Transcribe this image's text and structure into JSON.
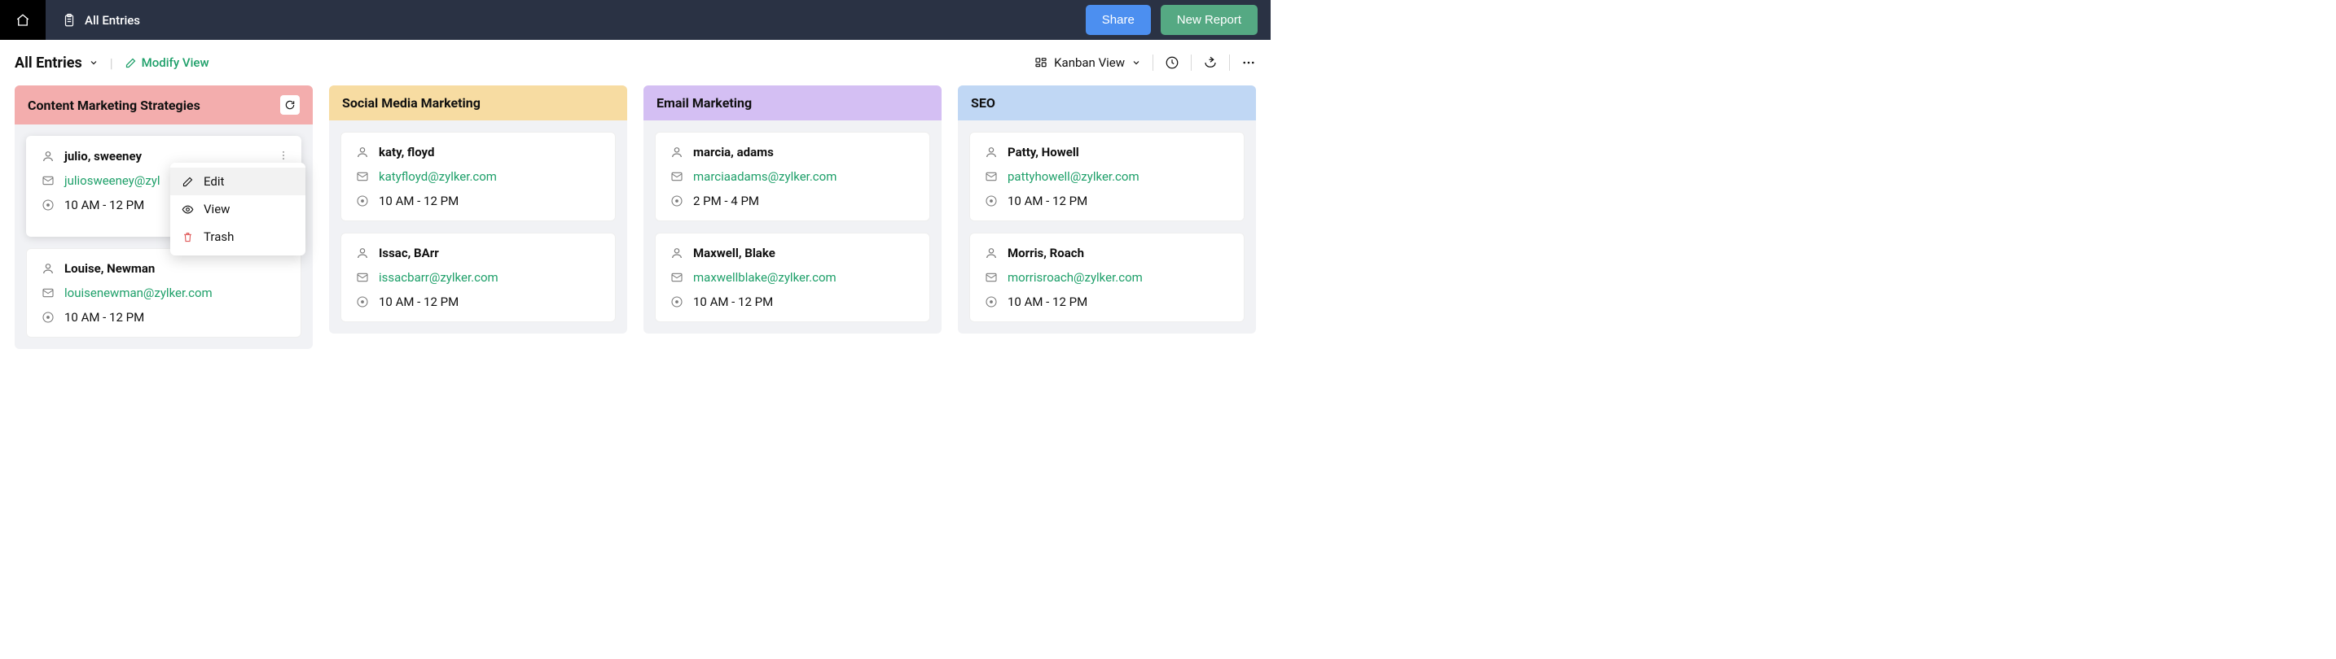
{
  "topbar": {
    "title": "All Entries",
    "share_label": "Share",
    "new_report_label": "New Report"
  },
  "secondbar": {
    "view_title": "All Entries",
    "modify_label": "Modify View",
    "view_mode": "Kanban View"
  },
  "context_menu": {
    "edit": "Edit",
    "view": "View",
    "trash": "Trash"
  },
  "columns": [
    {
      "title": "Content Marketing Strategies",
      "color": "pink",
      "has_refresh": true,
      "cards": [
        {
          "name": "julio, sweeney",
          "email": "juliosweeney@zyl",
          "time": "10 AM - 12 PM",
          "show_menu": true
        },
        {
          "name": "Louise, Newman",
          "email": "louisenewman@zylker.com",
          "time": "10 AM - 12 PM"
        }
      ]
    },
    {
      "title": "Social Media Marketing",
      "color": "yellow",
      "cards": [
        {
          "name": "katy, floyd",
          "email": "katyfloyd@zylker.com",
          "time": "10 AM - 12 PM"
        },
        {
          "name": "Issac, BArr",
          "email": "issacbarr@zylker.com",
          "time": "10 AM - 12 PM"
        }
      ]
    },
    {
      "title": "Email Marketing",
      "color": "purple",
      "cards": [
        {
          "name": "marcia, adams",
          "email": "marciaadams@zylker.com",
          "time": "2 PM - 4 PM"
        },
        {
          "name": "Maxwell, Blake",
          "email": "maxwellblake@zylker.com",
          "time": "10 AM - 12 PM"
        }
      ]
    },
    {
      "title": "SEO",
      "color": "blue",
      "cards": [
        {
          "name": "Patty, Howell",
          "email": "pattyhowell@zylker.com",
          "time": "10 AM - 12 PM"
        },
        {
          "name": "Morris, Roach",
          "email": "morrisroach@zylker.com",
          "time": "10 AM - 12 PM"
        }
      ]
    }
  ]
}
